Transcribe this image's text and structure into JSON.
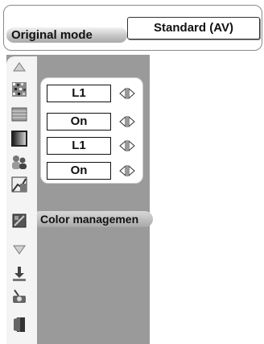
{
  "header": {
    "mode_label": "Original mode",
    "mode_value": "Standard (AV)"
  },
  "menu": {
    "icons": [
      "scroll-up-arrow-icon",
      "image-noise-icon",
      "gray-bars-icon",
      "gradient-box-icon",
      "people-icon",
      "chart-pencil-icon",
      "color-management-icon",
      "scroll-down-arrow-icon",
      "download-tray-icon",
      "projector-icon",
      "exit-door-icon"
    ],
    "selected_tooltip": "Color managemen"
  },
  "adjustments": {
    "rows": [
      {
        "value": "L1"
      },
      {
        "value": "On"
      },
      {
        "value": "L1"
      },
      {
        "value": "On"
      }
    ]
  },
  "colors": {
    "strip": "#9a9a9a",
    "icon_column": "#f4f4f4",
    "tooltip": "#b8b8b8"
  }
}
